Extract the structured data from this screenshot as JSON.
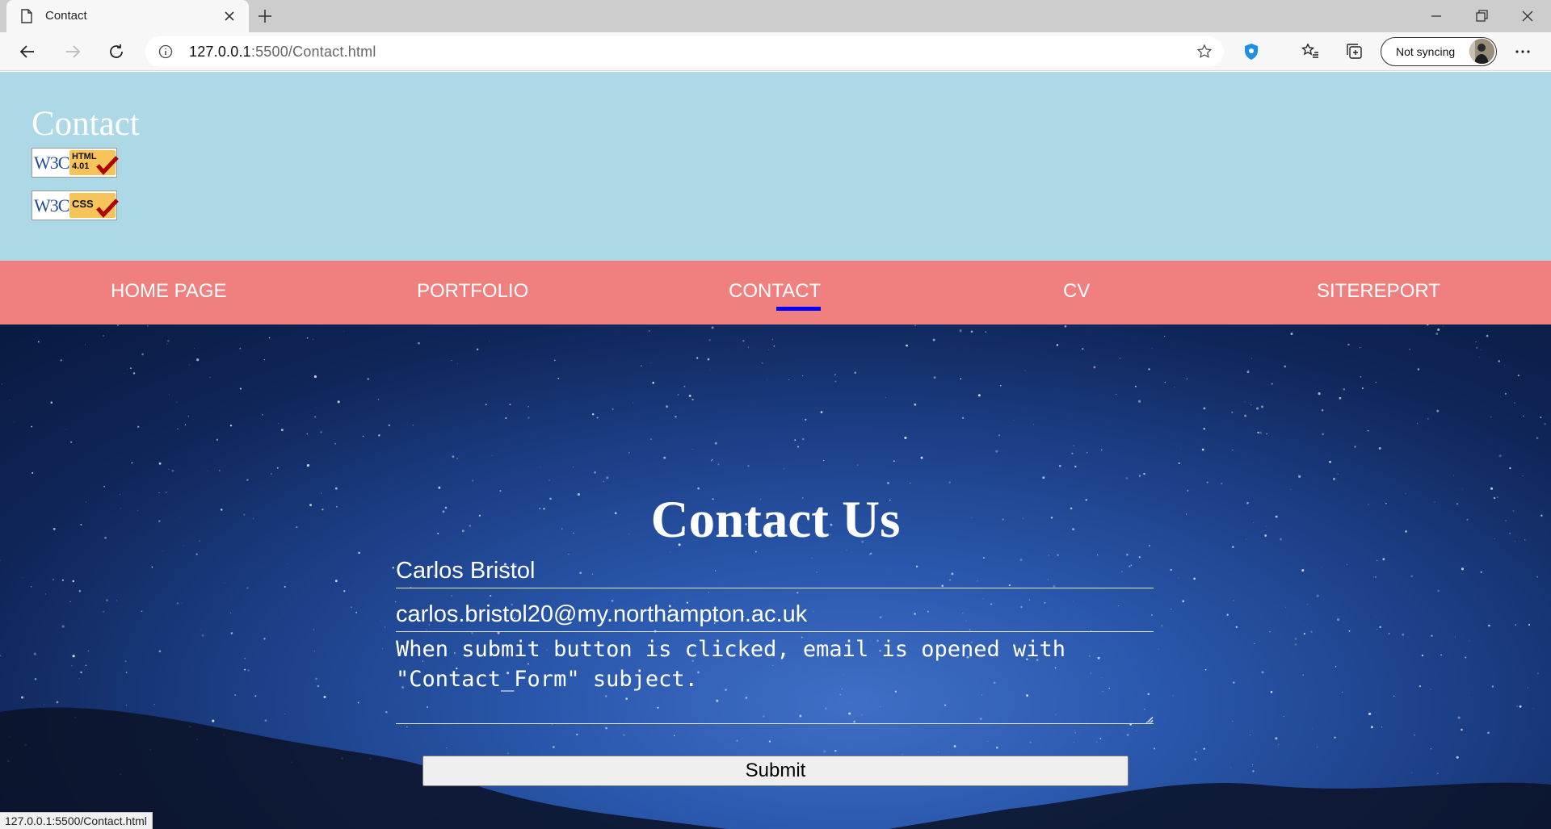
{
  "browser": {
    "tab_title": "Contact",
    "url_host": "127.0.0.1",
    "url_rest": ":5500/Contact.html",
    "sync_label": "Not syncing",
    "status_url": "127.0.0.1:5500/Contact.html"
  },
  "site": {
    "title": "Contact",
    "badges": [
      {
        "w3c": "W3C",
        "label": "HTML\n4.01"
      },
      {
        "w3c": "W3C",
        "label": "CSS"
      }
    ],
    "nav": [
      "HOME PAGE",
      "PORTFOLIO",
      "CONTACT",
      "CV",
      "SITEREPORT"
    ],
    "active_nav": "CONTACT"
  },
  "form": {
    "heading": "Contact Us",
    "name_value": "Carlos Bristol",
    "email_value": "carlos.bristol20@my.northampton.ac.uk",
    "message_value": "When submit button is clicked, email is opened with \"Contact_Form\" subject.",
    "submit_label": "Submit"
  },
  "colors": {
    "header_bg": "#add8e6",
    "nav_bg": "#f08080",
    "active_underline": "#0000ff"
  }
}
